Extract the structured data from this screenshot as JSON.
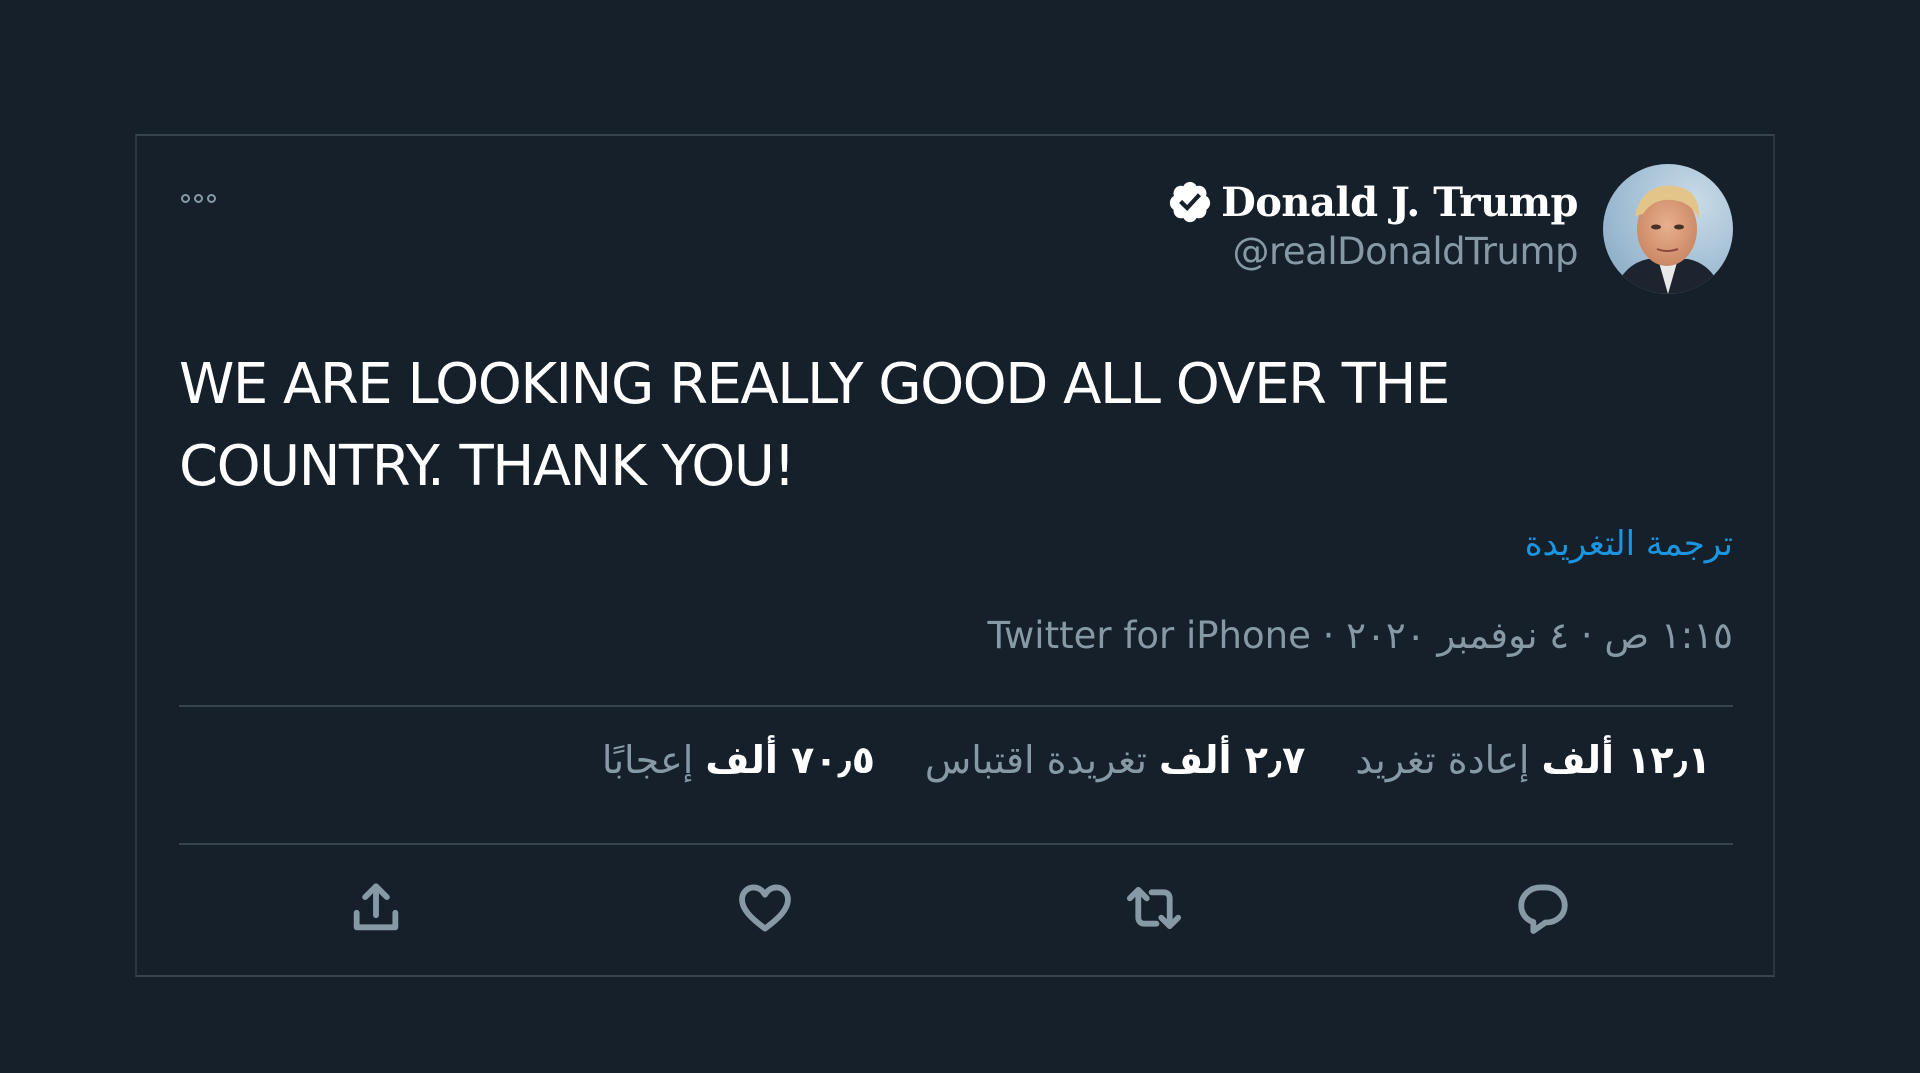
{
  "tweet": {
    "display_name": "Donald J. Trump",
    "handle": "@realDonaldTrump",
    "text": "WE ARE LOOKING REALLY GOOD ALL OVER THE COUNTRY. THANK YOU!",
    "translate_label": "ترجمة التغريدة",
    "meta": "١:١٥ ص · ٤ نوفمبر ٢٠٢٠ · Twitter for iPhone",
    "stats": {
      "retweets_value": "١٢٫١ ألف",
      "retweets_label": "إعادة تغريد",
      "quotes_value": "٢٫٧ ألف",
      "quotes_label": "تغريدة اقتباس",
      "likes_value": "٧٠٫٥ ألف",
      "likes_label": "إعجابًا"
    }
  },
  "colors": {
    "background": "#15202b",
    "text": "#ffffff",
    "secondary": "#8899a6",
    "link": "#1b95e0",
    "border": "#38444d"
  },
  "icons": [
    "more-icon",
    "verified-icon",
    "share-icon",
    "like-icon",
    "retweet-icon",
    "reply-icon"
  ]
}
